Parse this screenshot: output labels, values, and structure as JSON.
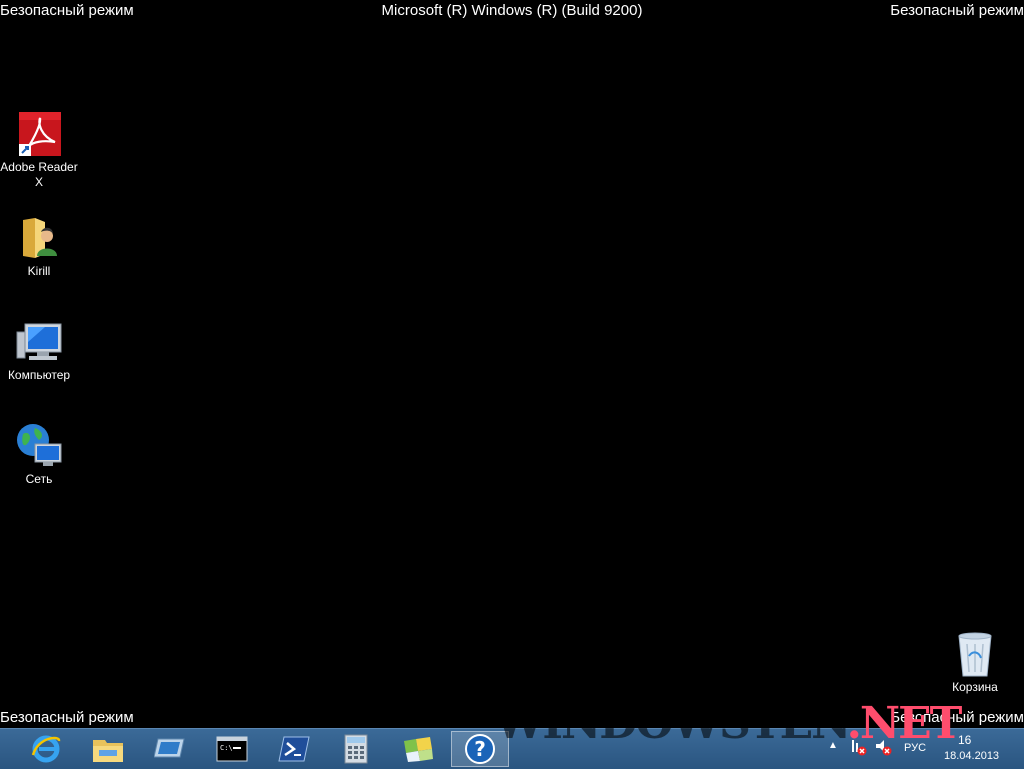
{
  "overlay": {
    "safe_mode": "Безопасный режим",
    "build": "Microsoft (R) Windows (R) (Build 9200)"
  },
  "desktop": {
    "icons": [
      {
        "label": "Adobe Reader X",
        "icon": "adobe-reader-icon"
      },
      {
        "label": "Kirill",
        "icon": "user-folder-icon"
      },
      {
        "label": "Компьютер",
        "icon": "computer-icon"
      },
      {
        "label": "Сеть",
        "icon": "network-icon"
      },
      {
        "label": "Корзина",
        "icon": "recycle-bin-icon"
      }
    ]
  },
  "taskbar": {
    "pinned": [
      "internet-explorer-icon",
      "file-explorer-icon",
      "remote-desktop-icon",
      "command-prompt-icon",
      "powershell-icon",
      "calculator-icon",
      "windows-logo-icon",
      "help-icon"
    ],
    "tray": {
      "language": "РУС",
      "time": "16",
      "date": "18.04.2013"
    }
  },
  "watermark": {
    "text": "WINDOWSTEN",
    "suffix": ".NET"
  },
  "colors": {
    "taskbar": "#2f5d8a",
    "desktop": "#000000",
    "watermark_accent": "#ff4d6d"
  }
}
